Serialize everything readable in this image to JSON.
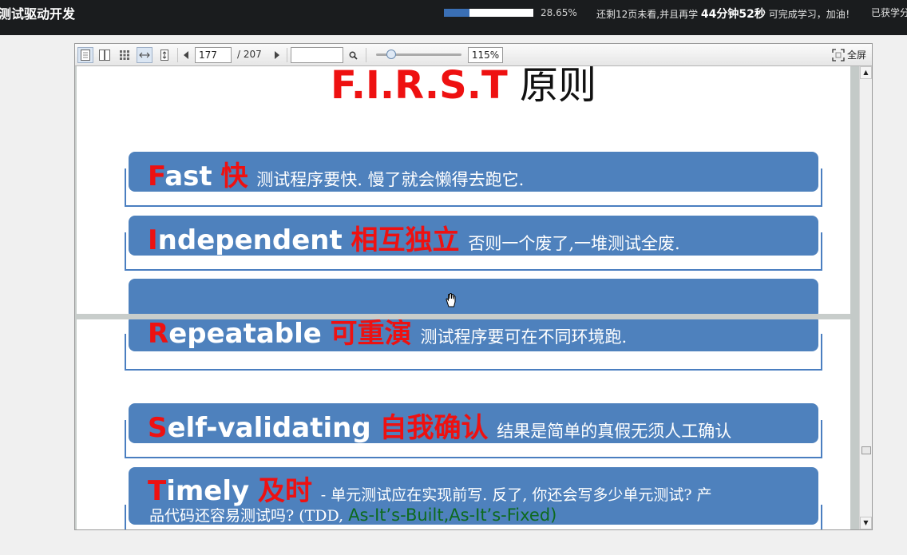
{
  "header": {
    "course_title": "测试驱动开发",
    "progress_percent": 28.65,
    "progress_text": "28.65%",
    "remain_prefix": "还剩12页未看,并且再学",
    "remain_time": "44分钟52秒",
    "remain_suffix": "可完成学习，加油！",
    "gained_text": "已获学分"
  },
  "toolbar": {
    "current_page": "177",
    "total_pages": "/ 207",
    "search_value": "",
    "zoom": "115%",
    "fullscreen_label": "全屏"
  },
  "slide_top": {
    "title_red": "F.I.R.S.T",
    "title_black": "原则",
    "items": [
      {
        "letter": "F",
        "word": "ast",
        "cn": "快",
        "desc": "测试程序要快. 慢了就会懒得去跑它."
      },
      {
        "letter": "I",
        "word": "ndependent",
        "cn": "相互独立",
        "desc": "否则一个废了,一堆测试全废."
      }
    ]
  },
  "slide_bottom": {
    "items": [
      {
        "letter": "R",
        "word": "epeatable",
        "cn": "可重演",
        "desc": "测试程序要可在不同环境跑."
      },
      {
        "letter": "S",
        "word": "elf-validating",
        "cn": "自我确认",
        "desc": "结果是简单的真假无须人工确认"
      },
      {
        "letter": "T",
        "word": "imely",
        "cn": "及时",
        "desc": "- 单元测试应在实现前写. 反了, 你还会写多少单元测试? 产",
        "desc2": "品代码还容易测试吗? (TDD, ",
        "desc_green": "As-It’s-Built,As-It’s-Fixed)"
      }
    ]
  }
}
